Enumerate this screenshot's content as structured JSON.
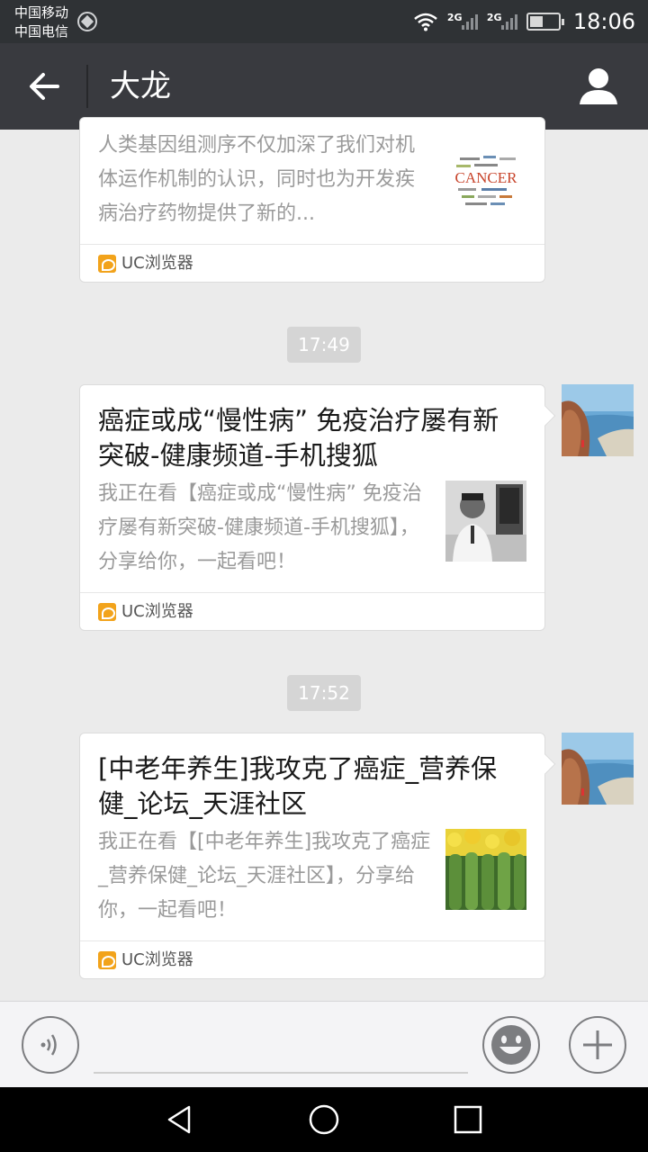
{
  "status_bar": {
    "carrier_1": "中国移动",
    "carrier_2": "中国电信",
    "net_1": "2G",
    "net_2": "2G",
    "time": "18:06"
  },
  "header": {
    "title": "大龙",
    "back_icon": "back-arrow-icon",
    "profile_icon": "person-icon"
  },
  "messages": [
    {
      "title": "",
      "description": "人类基因组测序不仅加深了我们对机体运作机制的认识，同时也为开发疾病治疗药物提供了新的...",
      "thumbnail": "CANCER",
      "source": "UC浏览器"
    },
    {
      "time": "17:49",
      "title": "癌症或成“慢性病” 免疫治疗屡有新突破-健康频道-手机搜狐",
      "description": "我正在看【癌症或成“慢性病” 免疫治疗屡有新突破-健康频道-手机搜狐】，分享给你，一起看吧！",
      "source": "UC浏览器"
    },
    {
      "time": "17:52",
      "title": "[中老年养生]我攻克了癌症_营养保健_论坛_天涯社区",
      "description": "我正在看【[中老年养生]我攻克了癌症_营养保健_论坛_天涯社区】，分享给你，一起看吧！",
      "source": "UC浏览器"
    }
  ],
  "input_bar": {
    "voice_icon": "voice-icon",
    "emoji_icon": "emoji-icon",
    "plus_icon": "plus-icon"
  },
  "colors": {
    "status_bar": "#2f3235",
    "header": "#393a3f",
    "background": "#ebebeb",
    "uc_orange": "#f2a31b"
  }
}
